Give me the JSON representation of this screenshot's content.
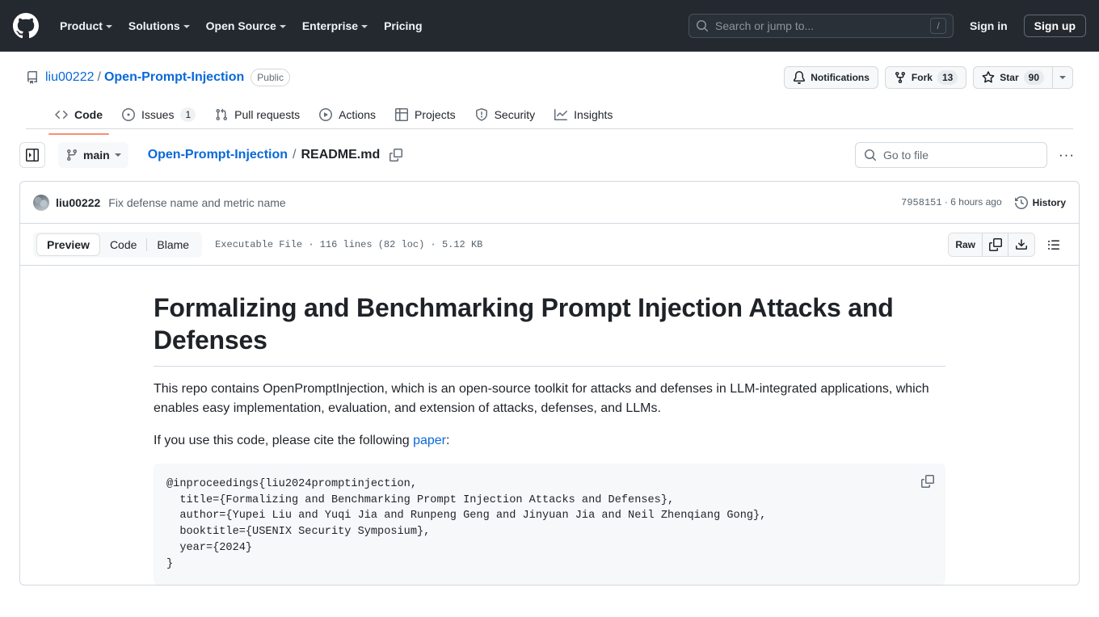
{
  "header": {
    "logo_icon": "github-mark-icon",
    "nav": [
      {
        "label": "Product",
        "has_caret": true
      },
      {
        "label": "Solutions",
        "has_caret": true
      },
      {
        "label": "Open Source",
        "has_caret": true
      },
      {
        "label": "Enterprise",
        "has_caret": true
      },
      {
        "label": "Pricing",
        "has_caret": false
      }
    ],
    "search": {
      "placeholder": "Search or jump to...",
      "shortcut": "/",
      "icon": "search-icon"
    },
    "sign_in": "Sign in",
    "sign_up": "Sign up",
    "background_color": "#24292f"
  },
  "repo": {
    "icon": "repo-icon",
    "owner": "liu00222",
    "separator": "/",
    "name": "Open-Prompt-Injection",
    "visibility": "Public",
    "actions": {
      "notifications": "Notifications",
      "fork_label": "Fork",
      "fork_count": "13",
      "star_label": "Star",
      "star_count": "90"
    },
    "tabs": [
      {
        "label": "Code",
        "icon": "code-icon",
        "count": "",
        "selected": true
      },
      {
        "label": "Issues",
        "icon": "issue-opened-icon",
        "count": "1",
        "selected": false
      },
      {
        "label": "Pull requests",
        "icon": "git-pull-request-icon",
        "count": "",
        "selected": false
      },
      {
        "label": "Actions",
        "icon": "play-icon",
        "count": "",
        "selected": false
      },
      {
        "label": "Projects",
        "icon": "table-icon",
        "count": "",
        "selected": false
      },
      {
        "label": "Security",
        "icon": "shield-icon",
        "count": "",
        "selected": false
      },
      {
        "label": "Insights",
        "icon": "graph-icon",
        "count": "",
        "selected": false
      }
    ],
    "accent_underline_color": "#fd8c73"
  },
  "file_toolbar": {
    "sidebar_toggle_icon": "sidebar-expand-icon",
    "branch_icon": "git-branch-icon",
    "branch": "main",
    "breadcrumb": {
      "root": "Open-Prompt-Injection",
      "separator": "/",
      "file": "README.md",
      "copy_icon": "copy-icon"
    },
    "go_to_file_placeholder": "Go to file",
    "go_to_file_icon": "search-icon",
    "more_options_icon": "kebab-horizontal-icon",
    "more_options_label": "···"
  },
  "commit": {
    "avatar": "user-avatar",
    "author": "liu00222",
    "message": "Fix defense name and metric name",
    "sha": "7958151",
    "separator": "·",
    "relative_time": "6 hours ago",
    "history_label": "History",
    "history_icon": "history-icon"
  },
  "view_toolbar": {
    "tabs": [
      {
        "label": "Preview",
        "active": true
      },
      {
        "label": "Code",
        "active": false
      },
      {
        "label": "Blame",
        "active": false
      }
    ],
    "file_meta": "Executable File · 116 lines (82 loc) · 5.12 KB",
    "raw_label": "Raw",
    "copy_icon": "copy-icon",
    "download_icon": "download-icon",
    "outline_icon": "list-unordered-icon"
  },
  "readme": {
    "title": "Formalizing and Benchmarking Prompt Injection Attacks and Defenses",
    "paragraph_1": "This repo contains OpenPromptInjection, which is an open-source toolkit for attacks and defenses in LLM-integrated applications, which enables easy implementation, evaluation, and extension of attacks, defenses, and LLMs.",
    "paragraph_2_before": "If you use this code, please cite the following ",
    "paragraph_2_link": "paper",
    "paragraph_2_after": ":",
    "citation": "@inproceedings{liu2024promptinjection,\n  title={Formalizing and Benchmarking Prompt Injection Attacks and Defenses},\n  author={Yupei Liu and Yuqi Jia and Runpeng Geng and Jinyuan Jia and Neil Zhenqiang Gong},\n  booktitle={USENIX Security Symposium},\n  year={2024}\n}",
    "citation_copy_icon": "copy-icon"
  },
  "colors": {
    "link": "#0969da",
    "header_bg": "#24292f",
    "border": "#d1d9e0",
    "muted_text": "#59636e",
    "code_bg": "#f6f8fa"
  }
}
